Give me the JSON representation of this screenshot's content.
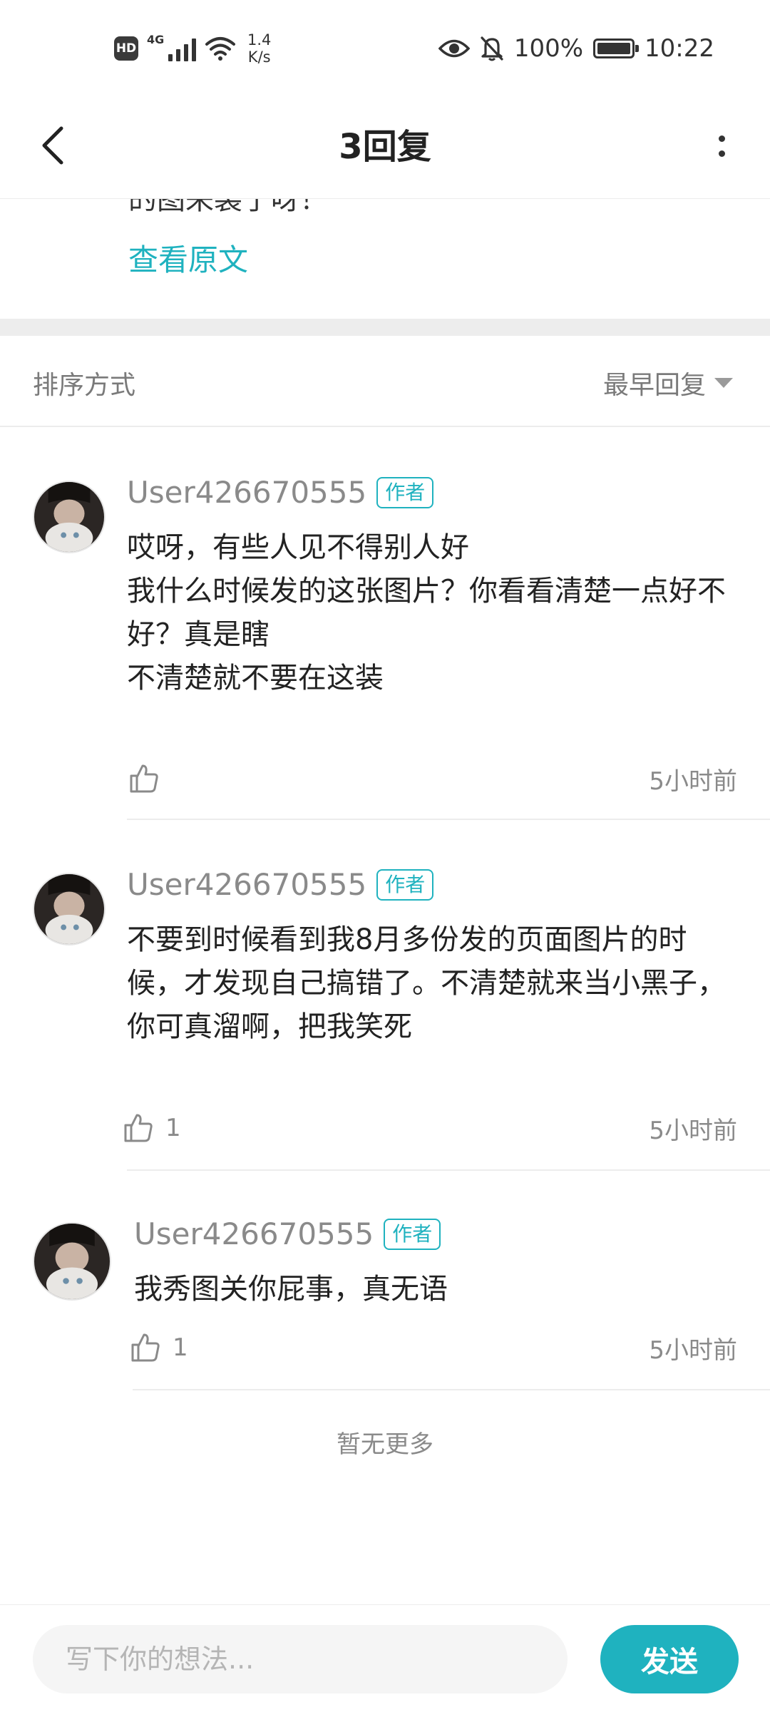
{
  "status_bar": {
    "hd": "HD",
    "network": "4G",
    "speed_value": "1.4",
    "speed_unit": "K/s",
    "battery": "100%",
    "battery_level": 1.0,
    "time": "10:22",
    "icons": [
      "hd-icon",
      "signal-icon",
      "wifi-icon",
      "eye-icon",
      "mute-icon",
      "battery-icon"
    ]
  },
  "header": {
    "title": "3回复",
    "back_icon": "chevron-left-icon",
    "more_icon": "vertical-dots-icon"
  },
  "original": {
    "cut_text": "的图来装了呀！",
    "view_original": "查看原文"
  },
  "sort": {
    "label": "排序方式",
    "selected": "最早回复"
  },
  "replies": [
    {
      "user": "User426670555",
      "badge": "作者",
      "text": "哎呀，有些人见不得别人好\n我什么时候发的这张图片？你看看清楚一点好不好？真是瞎\n不清楚就不要在这装",
      "likes": "",
      "time": "5小时前"
    },
    {
      "user": "User426670555",
      "badge": "作者",
      "text": "不要到时候看到我8月多份发的页面图片的时候，才发现自己搞错了。不清楚就来当小黑子，你可真溜啊，把我笑死",
      "likes": "1",
      "time": "5小时前"
    },
    {
      "user": "User426670555",
      "badge": "作者",
      "text": "我秀图关你屁事，真无语",
      "likes": "1",
      "time": "5小时前"
    }
  ],
  "footer_note": "暂无更多",
  "composer": {
    "placeholder": "写下你的想法...",
    "value": "",
    "send_label": "发送"
  },
  "colors": {
    "accent": "#1fb2bf",
    "muted_text": "#8a8a8a",
    "divider": "#ececec"
  }
}
